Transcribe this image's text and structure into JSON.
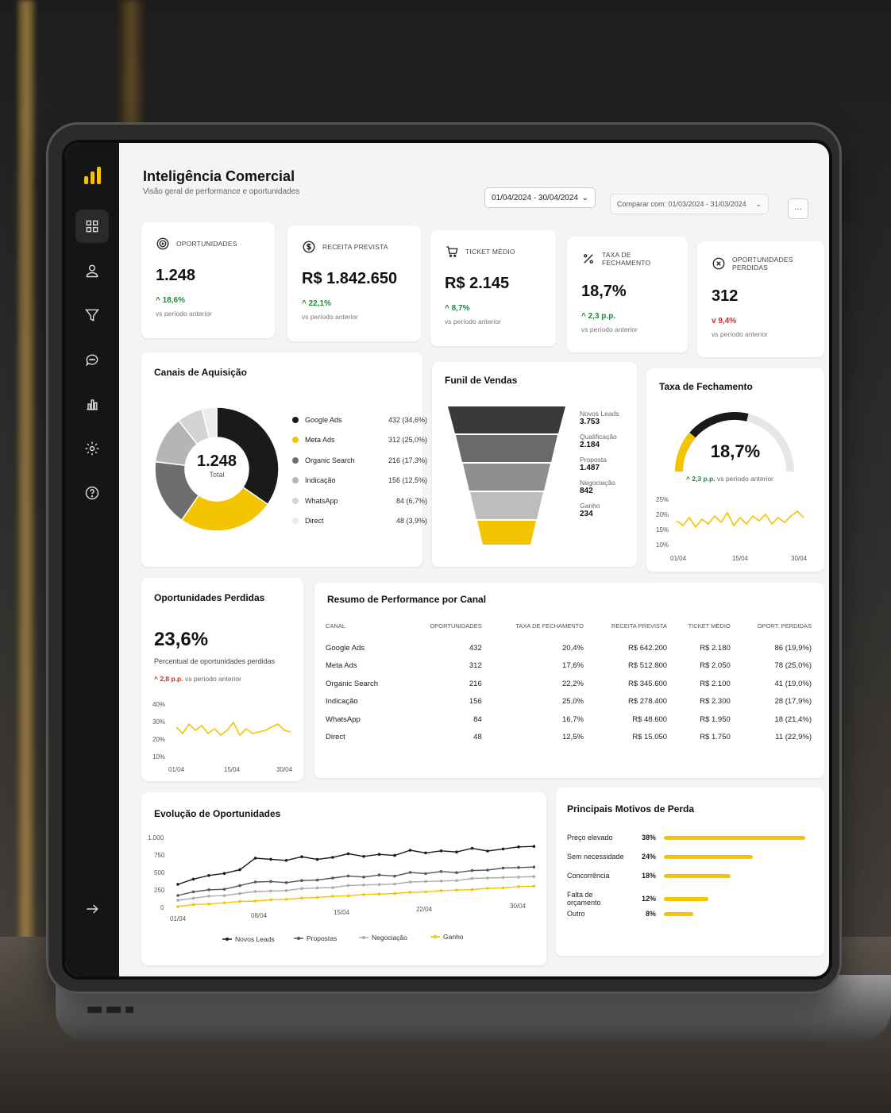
{
  "colors": {
    "accent": "#f5c400",
    "dark": "#151515",
    "up": "#1b8a3a",
    "down": "#d42a2a"
  },
  "sidebar": {
    "logo_icon": "bar-chart-logo-icon",
    "items": [
      {
        "icon": "grid-icon"
      },
      {
        "icon": "user-icon"
      },
      {
        "icon": "filter-icon"
      },
      {
        "icon": "chat-icon"
      },
      {
        "icon": "bar-chart-icon"
      },
      {
        "icon": "gear-icon"
      },
      {
        "icon": "help-icon"
      }
    ],
    "bottom_icon": "arrow-right-icon"
  },
  "header": {
    "title": "Inteligência Comercial",
    "subtitle": "Visão geral de performance e oportunidades",
    "date_range": "01/04/2024 - 30/04/2024",
    "compare": "Comparar com: 01/03/2024 - 31/03/2024",
    "more": "···"
  },
  "kpis": [
    {
      "label": "OPORTUNIDADES",
      "value": "1.248",
      "delta": "18,6%",
      "direction": "up",
      "cmp": "vs período anterior",
      "icon": "target-icon"
    },
    {
      "label": "RECEITA PREVISTA",
      "value": "R$ 1.842.650",
      "delta": "22,1%",
      "direction": "up",
      "cmp": "vs período anterior",
      "icon": "dollar-icon"
    },
    {
      "label": "TICKET MÉDIO",
      "value": "R$ 2.145",
      "delta": "8,7%",
      "direction": "up",
      "cmp": "vs período anterior",
      "icon": "cart-icon"
    },
    {
      "label": "TAXA DE FECHAMENTO",
      "value": "18,7%",
      "delta": "2,3 p.p.",
      "direction": "up",
      "cmp": "vs período anterior",
      "icon": "percent-icon"
    },
    {
      "label": "OPORTUNIDADES PERDIDAS",
      "value": "312",
      "delta": "9,4%",
      "direction": "down",
      "cmp": "vs período anterior",
      "icon": "x-circle-icon"
    }
  ],
  "channels": {
    "title": "Canais de Aquisição",
    "center_value": "1.248",
    "center_label": "Total",
    "items": [
      {
        "name": "Google Ads",
        "value": "432 (34,6%)",
        "color": "#1a1a1a"
      },
      {
        "name": "Meta Ads",
        "value": "312 (25,0%)",
        "color": "#f5c400"
      },
      {
        "name": "Organic Search",
        "value": "216 (17,3%)",
        "color": "#6e6e6e"
      },
      {
        "name": "Indicação",
        "value": "156 (12,5%)",
        "color": "#b5b5b5"
      },
      {
        "name": "WhatsApp",
        "value": "84 (6,7%)",
        "color": "#d4d4d4"
      },
      {
        "name": "Direct",
        "value": "48 (3,9%)",
        "color": "#ececec"
      }
    ]
  },
  "funnel": {
    "title": "Funil de Vendas",
    "stages": [
      {
        "label": "Novos Leads",
        "value": "3.753"
      },
      {
        "label": "Qualificação",
        "value": "2.184"
      },
      {
        "label": "Proposta",
        "value": "1.487"
      },
      {
        "label": "Negociação",
        "value": "842"
      },
      {
        "label": "Ganho",
        "value": "234"
      }
    ]
  },
  "close_rate": {
    "title": "Taxa de Fechamento",
    "value": "18,7%",
    "gauge_fraction": 0.4,
    "delta": "2,3 p.p.",
    "cmp": "vs período anterior",
    "y_ticks": [
      "25%",
      "20%",
      "15%",
      "10%"
    ],
    "x_ticks": [
      "01/04",
      "15/04",
      "30/04"
    ]
  },
  "lost": {
    "title": "Oportunidades Perdidas",
    "value": "23,6%",
    "desc": "Percentual de oportunidades perdidas",
    "delta": "2,8 p.p.",
    "cmp": "vs período anterior",
    "y_ticks": [
      "40%",
      "30%",
      "20%",
      "10%"
    ],
    "x_ticks": [
      "01/04",
      "15/04",
      "30/04"
    ]
  },
  "performance": {
    "title": "Resumo de Performance por Canal",
    "headers": [
      "CANAL",
      "OPORTUNIDADES",
      "TAXA DE FECHAMENTO",
      "RECEITA PREVISTA",
      "TICKET MÉDIO",
      "OPORT. PERDIDAS"
    ],
    "rows": [
      [
        "Google Ads",
        "432",
        "20,4%",
        "R$ 642.200",
        "R$ 2.180",
        "86 (19,9%)"
      ],
      [
        "Meta Ads",
        "312",
        "17,6%",
        "R$ 512.800",
        "R$ 2.050",
        "78 (25,0%)"
      ],
      [
        "Organic Search",
        "216",
        "22,2%",
        "R$ 345.600",
        "R$ 2.100",
        "41 (19,0%)"
      ],
      [
        "Indicação",
        "156",
        "25,0%",
        "R$ 278.400",
        "R$ 2.300",
        "28 (17,9%)"
      ],
      [
        "WhatsApp",
        "84",
        "16,7%",
        "R$ 48.600",
        "R$ 1.950",
        "18 (21,4%)"
      ],
      [
        "Direct",
        "48",
        "12,5%",
        "R$ 15.050",
        "R$ 1.750",
        "11 (22,9%)"
      ]
    ]
  },
  "evolution": {
    "title": "Evolução de Oportunidades",
    "y_ticks": [
      "1.000",
      "750",
      "500",
      "250",
      "0"
    ],
    "x_ticks": [
      "01/04",
      "08/04",
      "15/04",
      "22/04",
      "30/04"
    ],
    "legend": [
      "Novos Leads",
      "Propostas",
      "Negociação",
      "Ganho"
    ]
  },
  "reasons": {
    "title": "Principais Motivos de Perda",
    "items": [
      {
        "label": "Preço elevado",
        "pct": "38%",
        "value": 38
      },
      {
        "label": "Sem necessidade",
        "pct": "24%",
        "value": 24
      },
      {
        "label": "Concorrência",
        "pct": "18%",
        "value": 18
      },
      {
        "label": "Falta de orçamento",
        "pct": "12%",
        "value": 12
      },
      {
        "label": "Outro",
        "pct": "8%",
        "value": 8
      }
    ]
  }
}
